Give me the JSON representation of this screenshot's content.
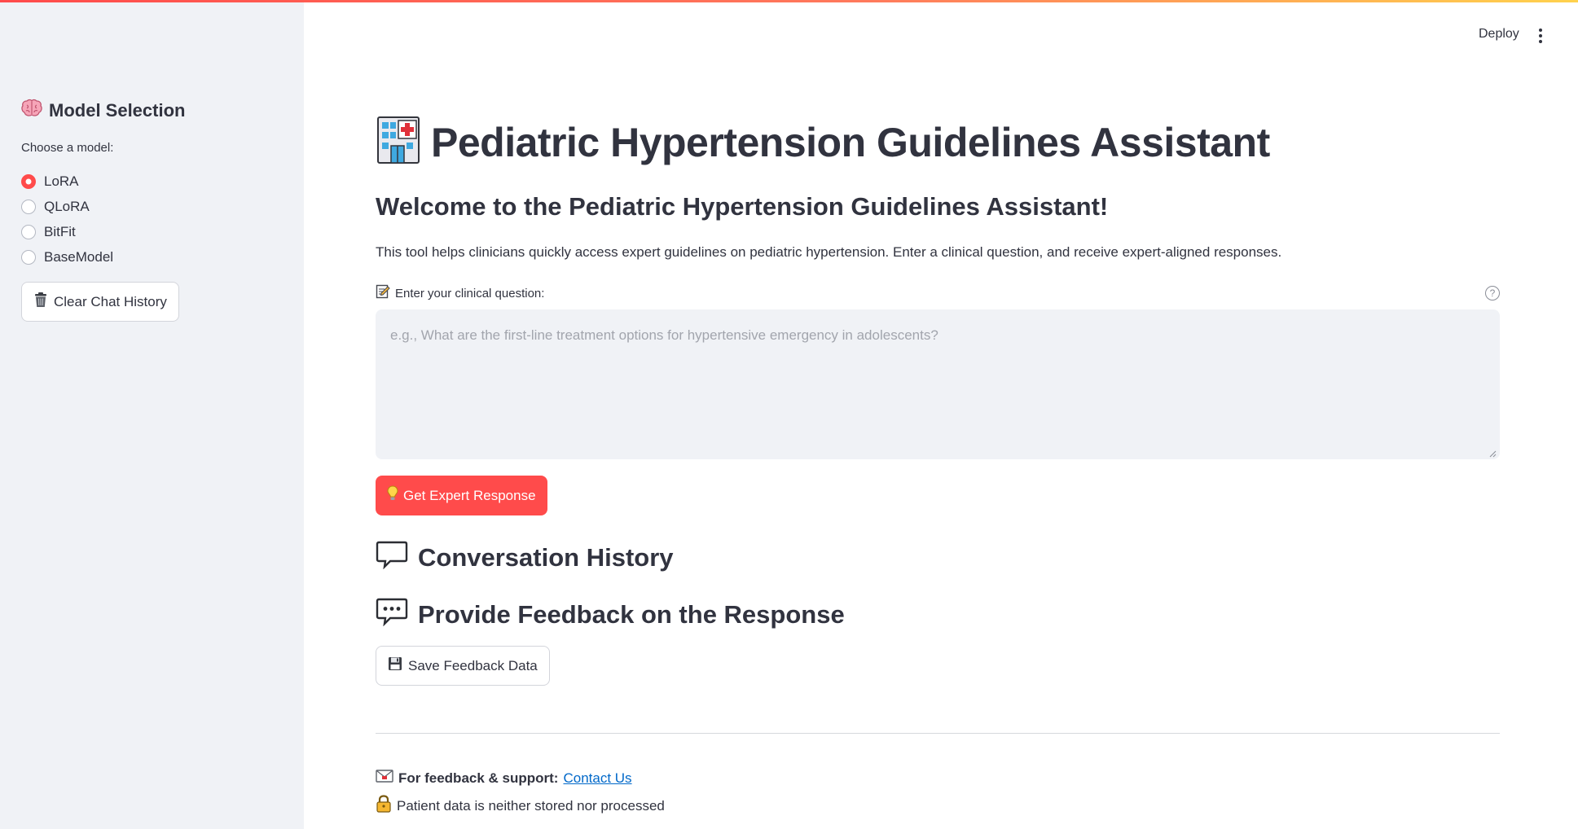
{
  "top_bar": {
    "deploy_label": "Deploy"
  },
  "sidebar": {
    "header": "Model Selection",
    "radio_label": "Choose a model:",
    "models": [
      "LoRA",
      "QLoRA",
      "BitFit",
      "BaseModel"
    ],
    "selected_model": "LoRA",
    "clear_button_label": "Clear Chat History"
  },
  "main": {
    "title": "Pediatric Hypertension Guidelines Assistant",
    "welcome_heading": "Welcome to the Pediatric Hypertension Guidelines Assistant!",
    "intro": "This tool helps clinicians quickly access expert guidelines on pediatric hypertension. Enter a clinical question, and receive expert-aligned responses.",
    "question_label": "Enter your clinical question:",
    "question_placeholder": "e.g., What are the first-line treatment options for hypertensive emergency in adolescents?",
    "question_value": "",
    "submit_button_label": "Get Expert Response",
    "conversation_heading": "Conversation History",
    "feedback_heading": "Provide Feedback on the Response",
    "save_feedback_label": "Save Feedback Data"
  },
  "footer": {
    "support_prefix": "For feedback & support:",
    "contact_link": "Contact Us",
    "privacy_note": "Patient data is neither stored nor processed"
  },
  "colors": {
    "primary": "#ff4b4b",
    "sidebar_bg": "#f0f2f6",
    "link": "#0068c9",
    "text": "#31333f"
  }
}
